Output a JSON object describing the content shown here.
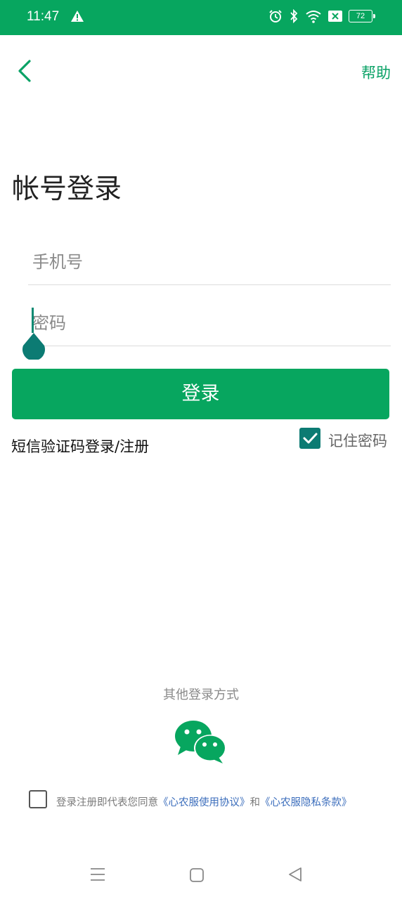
{
  "status_bar": {
    "time": "11:47",
    "battery": "72",
    "icons": [
      "warning-icon",
      "alarm-icon",
      "bluetooth-icon",
      "wifi-icon",
      "sim-off-icon",
      "battery-icon"
    ]
  },
  "header": {
    "back_icon": "chevron-left-icon",
    "help_label": "帮助"
  },
  "page": {
    "title": "帐号登录"
  },
  "form": {
    "phone_placeholder": "手机号",
    "password_placeholder": "密码",
    "login_button": "登录",
    "sms_login_link": "短信验证码登录/注册",
    "remember_password": "记住密码",
    "remember_checked": true
  },
  "other_login": {
    "label": "其他登录方式",
    "icon": "wechat-icon"
  },
  "agreement": {
    "checked": false,
    "prefix": "登录注册即代表您同意",
    "user_agreement": "《心农服使用协议》",
    "conjunction": "和",
    "privacy_policy": "《心农服隐私条款》"
  },
  "nav_bar": {
    "icons": [
      "menu-icon",
      "home-icon",
      "back-triangle-icon"
    ]
  },
  "colors": {
    "brand_green": "#07a65f",
    "checkbox_teal": "#0c7b73",
    "link_blue": "#3c6ebc"
  }
}
